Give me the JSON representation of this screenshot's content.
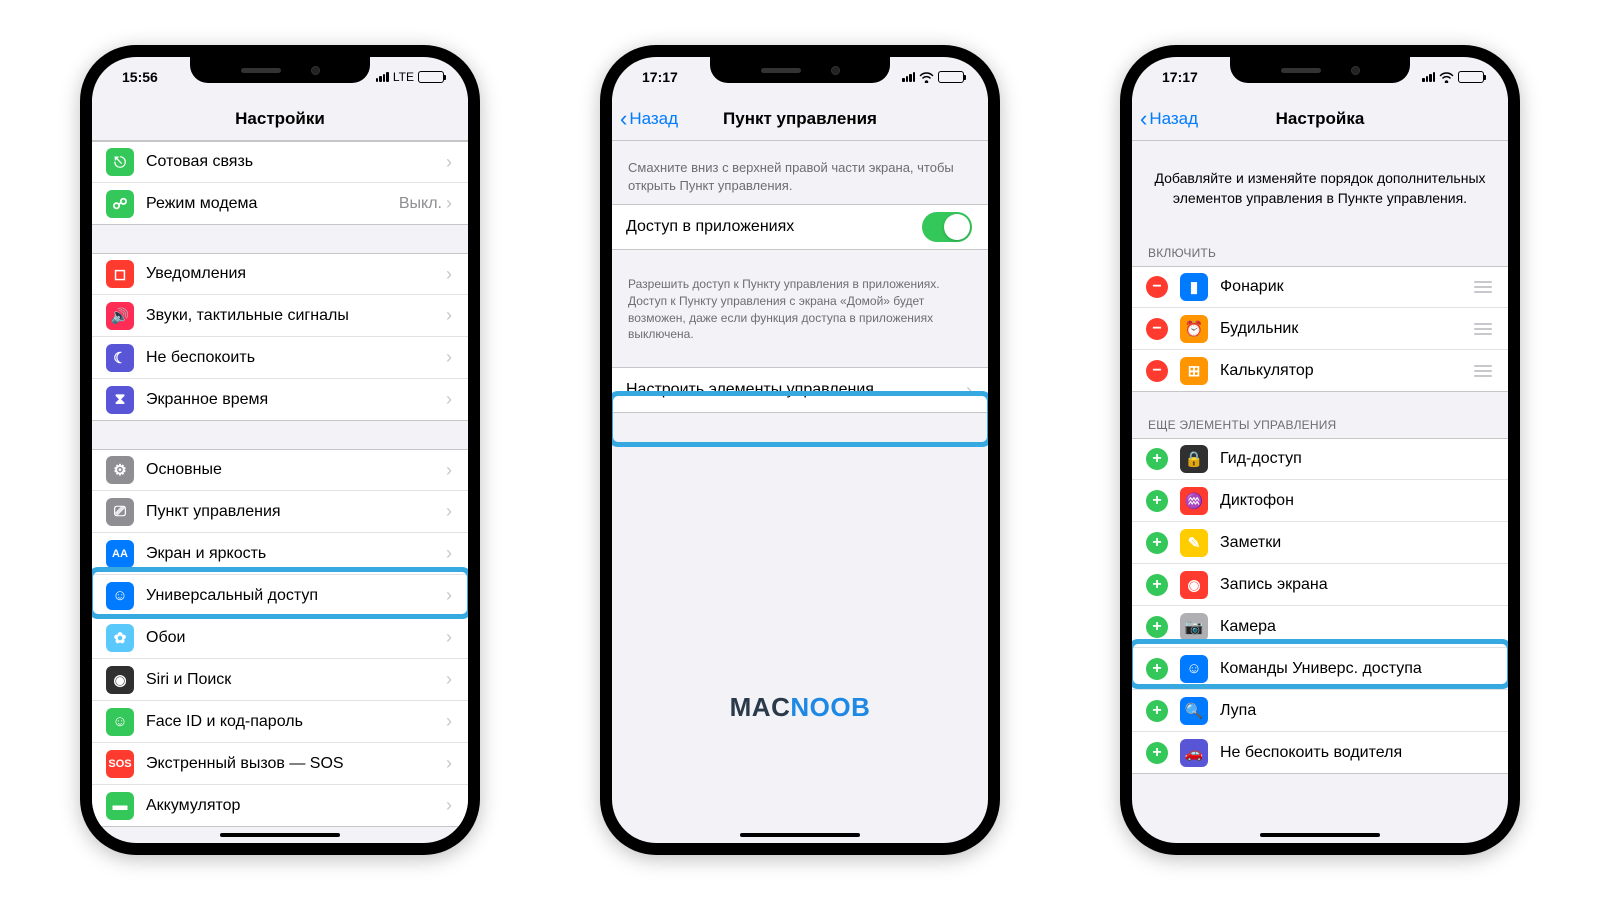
{
  "phone1": {
    "time": "15:56",
    "net": "LTE",
    "title": "Настройки",
    "items_a": [
      {
        "label": "Сотовая связь"
      },
      {
        "label": "Режим модема",
        "detail": "Выкл."
      }
    ],
    "items_b": [
      {
        "label": "Уведомления"
      },
      {
        "label": "Звуки, тактильные сигналы"
      },
      {
        "label": "Не беспокоить"
      },
      {
        "label": "Экранное время"
      }
    ],
    "items_c": [
      {
        "label": "Основные"
      },
      {
        "label": "Пункт управления"
      },
      {
        "label": "Экран и яркость"
      },
      {
        "label": "Универсальный доступ"
      },
      {
        "label": "Обои"
      },
      {
        "label": "Siri и Поиск"
      },
      {
        "label": "Face ID и код-пароль"
      },
      {
        "label": "Экстренный вызов — SOS"
      },
      {
        "label": "Аккумулятор"
      }
    ]
  },
  "phone2": {
    "time": "17:17",
    "back": "Назад",
    "title": "Пункт управления",
    "hint1": "Смахните вниз с верхней правой части экрана, чтобы открыть Пункт управления.",
    "toggle_label": "Доступ в приложениях",
    "hint2": "Разрешить доступ к Пункту управления в приложениях. Доступ к Пункту управления с экрана «Домой» будет возможен, даже если функция доступа в приложениях выключена.",
    "customize": "Настроить элементы управления",
    "watermark_a": "MAC",
    "watermark_b": "NOOB"
  },
  "phone3": {
    "time": "17:17",
    "back": "Назад",
    "title": "Настройка",
    "desc": "Добавляйте и изменяйте порядок дополнительных элементов управления в Пункте управления.",
    "section_include": "Включить",
    "section_more": "Еще элементы управления",
    "included": [
      {
        "label": "Фонарик"
      },
      {
        "label": "Будильник"
      },
      {
        "label": "Калькулятор"
      }
    ],
    "more": [
      {
        "label": "Гид-доступ"
      },
      {
        "label": "Диктофон"
      },
      {
        "label": "Заметки"
      },
      {
        "label": "Запись экрана"
      },
      {
        "label": "Камера"
      },
      {
        "label": "Команды Универс. доступа"
      },
      {
        "label": "Лупа"
      },
      {
        "label": "Не беспокоить водителя"
      }
    ]
  }
}
